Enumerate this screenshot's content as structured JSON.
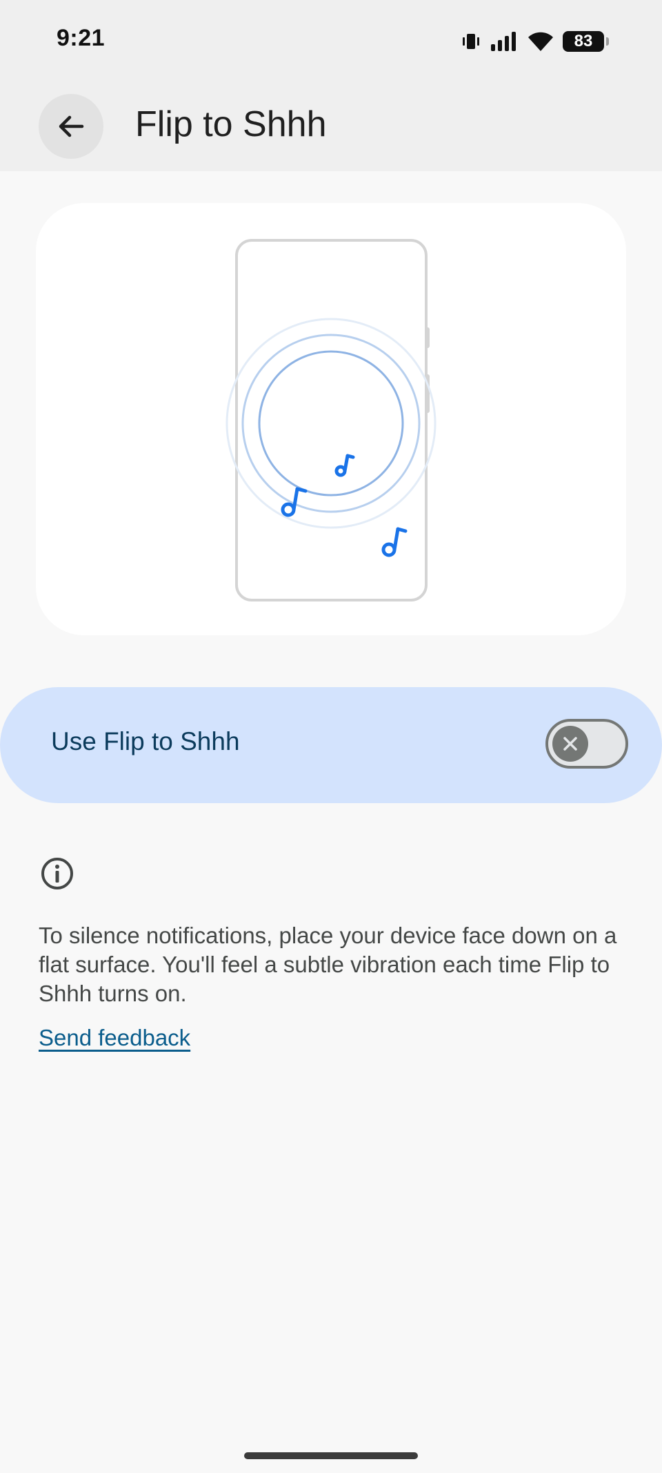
{
  "status_bar": {
    "time": "9:21",
    "battery_level": "83",
    "icons": [
      "vibrate-icon",
      "signal-icon",
      "wifi-icon",
      "battery-icon"
    ]
  },
  "header": {
    "back_icon": "arrow-back-icon",
    "title": "Flip to Shhh"
  },
  "illustration": {
    "icons": [
      "phone-outline-icon",
      "ripple-circles-icon",
      "music-note-icon"
    ],
    "accent_color": "#1a73e8"
  },
  "toggle": {
    "label": "Use Flip to Shhh",
    "state": "off",
    "background_color": "#d3e3fd"
  },
  "info": {
    "icon": "info-icon",
    "description": "To silence notifications, place your device face down on a flat surface. You'll feel a subtle vibration each time Flip to Shhh turns on.",
    "link_label": "Send feedback"
  }
}
